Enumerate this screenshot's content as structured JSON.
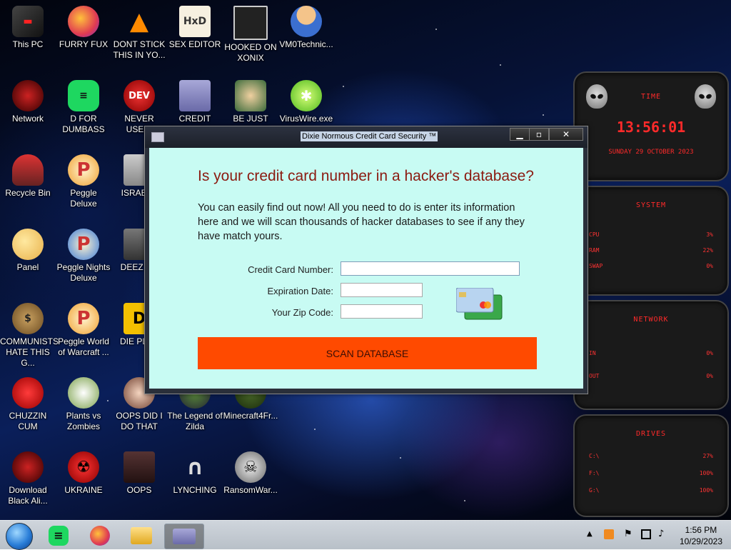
{
  "desktop": {
    "icons": [
      {
        "label": "This PC"
      },
      {
        "label": "FURRY FUX"
      },
      {
        "label": "DONT STICK THIS IN YO..."
      },
      {
        "label": "SEX EDITOR"
      },
      {
        "label": "HOOKED ON XONIX"
      },
      {
        "label": "VM0Technic..."
      },
      {
        "label": "Network"
      },
      {
        "label": "D FOR DUMBASS"
      },
      {
        "label": "NEVER USED!"
      },
      {
        "label": "CREDIT CARD CHECKER"
      },
      {
        "label": "BE JUST LIKE THE DUDE!"
      },
      {
        "label": "VirusWire.exe"
      },
      {
        "label": "Recycle Bin"
      },
      {
        "label": "Peggle Deluxe"
      },
      {
        "label": "ISRAELS"
      },
      {
        "label": "Panel"
      },
      {
        "label": "Peggle Nights Deluxe"
      },
      {
        "label": "DEEZ NU"
      },
      {
        "label": "COMMUNISTS HATE THIS G..."
      },
      {
        "label": "Peggle World of Warcraft ..."
      },
      {
        "label": "DIE PLEA"
      },
      {
        "label": "CHUZZIN CUM"
      },
      {
        "label": "Plants vs Zombies"
      },
      {
        "label": "OOPS DID I DO THAT"
      },
      {
        "label": "The Legend of Zilda"
      },
      {
        "label": "Minecraft4Fr..."
      },
      {
        "label": "Download Black Ali..."
      },
      {
        "label": "UKRAINE"
      },
      {
        "label": "OOPS"
      },
      {
        "label": "LYNCHING"
      },
      {
        "label": "RansomWar..."
      }
    ]
  },
  "widget": {
    "time": {
      "header": "TIME",
      "clock": "13:56:01",
      "date": "SUNDAY 29 OCTOBER 2023"
    },
    "system": {
      "header": "SYSTEM",
      "rows": [
        {
          "k": "CPU",
          "v": "3%"
        },
        {
          "k": "RAM",
          "v": "22%"
        },
        {
          "k": "SWAP",
          "v": "0%"
        }
      ]
    },
    "network": {
      "header": "NETWORK",
      "rows": [
        {
          "k": "IN",
          "v": "0%"
        },
        {
          "k": "OUT",
          "v": "0%"
        }
      ]
    },
    "drives": {
      "header": "DRIVES",
      "rows": [
        {
          "k": "C:\\",
          "v": "27%"
        },
        {
          "k": "F:\\",
          "v": "100%"
        },
        {
          "k": "G:\\",
          "v": "100%"
        }
      ]
    }
  },
  "dialog": {
    "title": "Dixie Normous Credit Card Security ™",
    "heading": "Is your credit card number in a hacker's database?",
    "intro": "You can easily find out now! All you need to do is enter its information here and we will scan thousands of hacker databases to see if any they have match yours.",
    "fields": {
      "cc_label": "Credit Card Number:",
      "cc_value": "",
      "exp_label": "Expiration Date:",
      "exp_value": "",
      "zip_label": "Your Zip Code:",
      "zip_value": ""
    },
    "scan_label": "SCAN DATABASE"
  },
  "taskbar": {
    "time": "1:56 PM",
    "date": "10/29/2023",
    "apps": [
      "start-orb",
      "notes-app",
      "firefox",
      "file-explorer",
      "credit-card-checker"
    ]
  },
  "colors": {
    "dialog_bg": "#c8fbf3",
    "heading": "#8b1a10",
    "scan_button": "#ff4a00",
    "widget_red": "#ff2a2a"
  }
}
